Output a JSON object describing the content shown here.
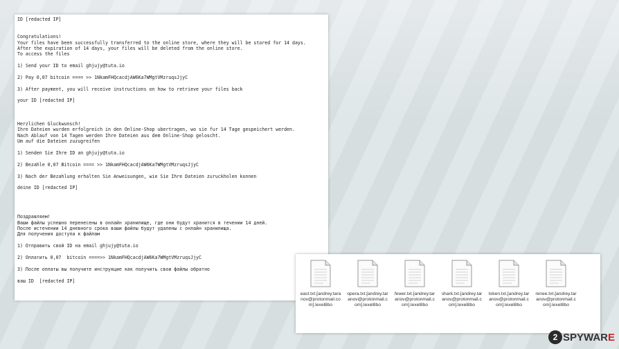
{
  "note": {
    "lines": [
      "ID [redacted IP]",
      "",
      "",
      "Congratulations!",
      "Your files have been successfully transferred to the online store, where they will be stored for 14 days.",
      "After the expiration of 14 days, your files will be deleted from the online store.",
      "To access the files",
      "",
      "1) Send your ID to email ghjujy@tuta.io",
      "",
      "2) Pay 0,07 bitcoin ==== >> 1NkamFHQcacdjAW6Ka7WMgtVMzruqsJjyC",
      "",
      "3) After payment, you will receive instructions on how to retrieve your files back",
      "",
      "your ID [redacted IP]",
      "",
      "",
      "",
      "Herzlichen Gluckwunsch!",
      "Ihre Dateien wurden erfolgreich in den Online-Shop ubertragen, wo sie fur 14 Tage gespeichert werden.",
      "Nach Ablauf von 14 Tagen werden Ihre Dateien aus dem Online-Shop geloscht.",
      "Um auf die Dateien zuzugreifen",
      "",
      "1) Senden Sie Ihre ID an ghjujy@tuta.io",
      "",
      "2) Bezahle 0,07 Bitcoin ==== >> 1NkamFHQcacdjAW6Ka7WMgtVMzruqsJjyC",
      "",
      "3) Nach der Bezahlung erhalten Sie Anweisungen, wie Sie Ihre Dateien zuruckholen konnen",
      "",
      "deine ID [redacted IP]",
      "",
      "",
      "",
      "",
      "Поздравляем!",
      "Ваши файлы успешно перенесены в онлайн хранилище, где они будут хранится в течении 14 дней.",
      "После истечении 14 дневного срока ваши файлы будут удалены с онлайн хранилища.",
      "Для получения доступа к файлам",
      "",
      "1) Отправить свой ID на email ghjujy@tuta.io",
      "",
      "2) Оплатить 0,07  bitcoin ====>> 1NkamFHQcacdjAW6Ka7WMgtVMzruqsJjyC",
      "",
      "3) После оплаты вы получите инструкцие как получить свои файлы обратно",
      "",
      "ваш ID  [redacted IP]"
    ]
  },
  "files": [
    {
      "name": "east.txt.[andrey.taranov@protonmail.com].lexel8bo",
      "icon": "text-file-icon"
    },
    {
      "name": "opera.txt.[andrey.taranov@protonmail.com].lexel8bo",
      "icon": "text-file-icon"
    },
    {
      "name": "fewer.txt.[andrey.taranov@protonmail.com].lexel8bo",
      "icon": "text-file-icon"
    },
    {
      "name": "shark.txt.[andrey.taranov@protonmail.com].lexel8bo",
      "icon": "text-file-icon"
    },
    {
      "name": "token.txt.[andrey.taranov@protonmail.com].lexel8bo",
      "icon": "text-file-icon"
    },
    {
      "name": "renee.txt.[andrey.taranov@protonmail.com].lexel8bo",
      "icon": "text-file-icon"
    }
  ],
  "watermark": {
    "num": "2",
    "text1": "SPYWAR",
    "text2": "E",
    "accent": "#d02020"
  }
}
